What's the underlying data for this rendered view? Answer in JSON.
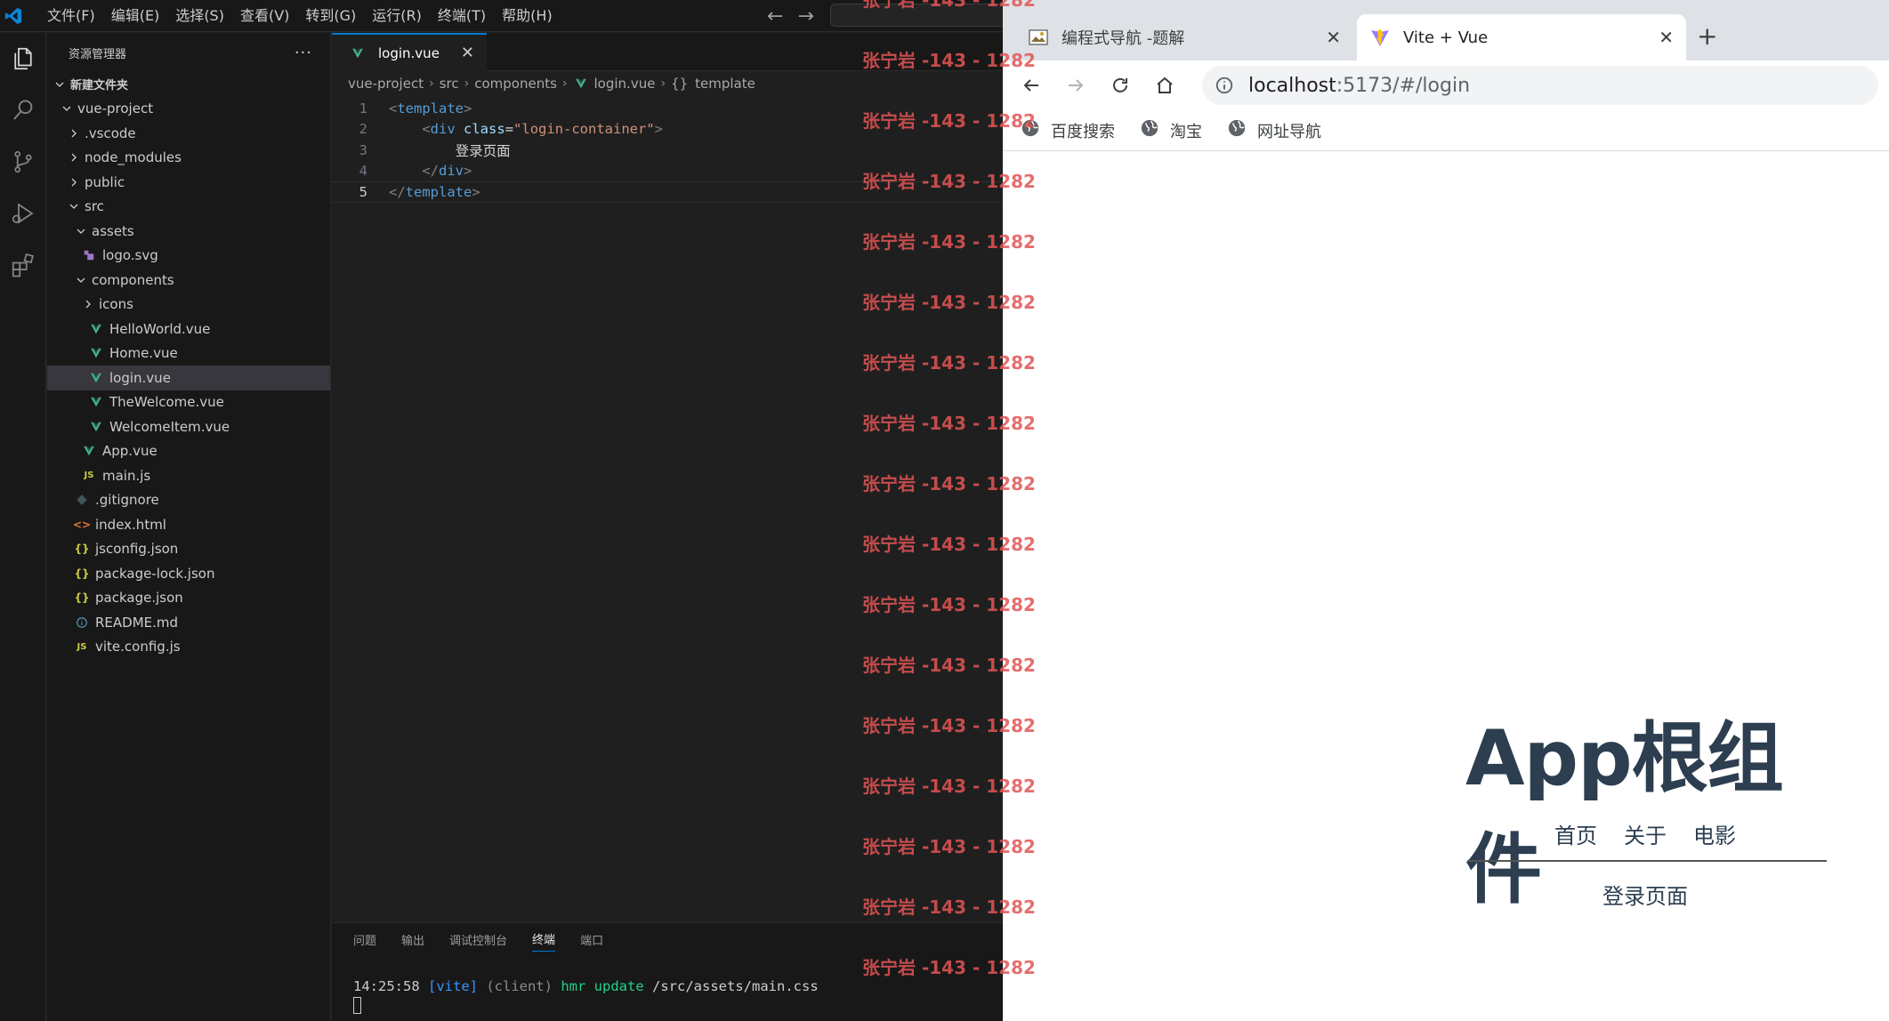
{
  "vscode": {
    "menu": [
      "文件(F)",
      "编辑(E)",
      "选择(S)",
      "查看(V)",
      "转到(G)",
      "运行(R)",
      "终端(T)",
      "帮助(H)"
    ],
    "explorer_title": "资源管理器",
    "explorer_more": "···",
    "folder_root": "新建文件夹",
    "tree": [
      {
        "label": "vue-project",
        "depth": 1,
        "kind": "folder-open"
      },
      {
        "label": ".vscode",
        "depth": 2,
        "kind": "folder"
      },
      {
        "label": "node_modules",
        "depth": 2,
        "kind": "folder"
      },
      {
        "label": "public",
        "depth": 2,
        "kind": "folder"
      },
      {
        "label": "src",
        "depth": 2,
        "kind": "folder-open"
      },
      {
        "label": "assets",
        "depth": 3,
        "kind": "folder-open"
      },
      {
        "label": "logo.svg",
        "depth": 4,
        "kind": "svg"
      },
      {
        "label": "components",
        "depth": 3,
        "kind": "folder-open"
      },
      {
        "label": "icons",
        "depth": 4,
        "kind": "folder"
      },
      {
        "label": "HelloWorld.vue",
        "depth": 5,
        "kind": "vue"
      },
      {
        "label": "Home.vue",
        "depth": 5,
        "kind": "vue"
      },
      {
        "label": "login.vue",
        "depth": 5,
        "kind": "vue",
        "selected": true
      },
      {
        "label": "TheWelcome.vue",
        "depth": 5,
        "kind": "vue"
      },
      {
        "label": "WelcomeItem.vue",
        "depth": 5,
        "kind": "vue"
      },
      {
        "label": "App.vue",
        "depth": 4,
        "kind": "vue"
      },
      {
        "label": "main.js",
        "depth": 4,
        "kind": "js"
      },
      {
        "label": ".gitignore",
        "depth": 3,
        "kind": "git"
      },
      {
        "label": "index.html",
        "depth": 3,
        "kind": "html"
      },
      {
        "label": "jsconfig.json",
        "depth": 3,
        "kind": "json"
      },
      {
        "label": "package-lock.json",
        "depth": 3,
        "kind": "json"
      },
      {
        "label": "package.json",
        "depth": 3,
        "kind": "json"
      },
      {
        "label": "README.md",
        "depth": 3,
        "kind": "info"
      },
      {
        "label": "vite.config.js",
        "depth": 3,
        "kind": "js"
      }
    ],
    "tab": {
      "label": "login.vue",
      "close": "✕"
    },
    "breadcrumb": [
      "vue-project",
      "src",
      "components",
      "login.vue",
      "template"
    ],
    "code_lines": [
      {
        "n": "1",
        "tokens": [
          [
            "tk-punct",
            "<"
          ],
          [
            "tk-tag",
            "template"
          ],
          [
            "tk-punct",
            ">"
          ]
        ]
      },
      {
        "n": "2",
        "tokens": [
          [
            "tk-text",
            "    "
          ],
          [
            "tk-punct",
            "<"
          ],
          [
            "tk-tag",
            "div"
          ],
          [
            "tk-text",
            " "
          ],
          [
            "tk-attr",
            "class"
          ],
          [
            "tk-text",
            "="
          ],
          [
            "tk-str",
            "\"login-container\""
          ],
          [
            "tk-punct",
            ">"
          ]
        ]
      },
      {
        "n": "3",
        "tokens": [
          [
            "tk-text",
            "        登录页面"
          ]
        ]
      },
      {
        "n": "4",
        "tokens": [
          [
            "tk-text",
            "    "
          ],
          [
            "tk-punct",
            "</"
          ],
          [
            "tk-tag",
            "div"
          ],
          [
            "tk-punct",
            ">"
          ]
        ]
      },
      {
        "n": "5",
        "tokens": [
          [
            "tk-punct",
            "</"
          ],
          [
            "tk-tag",
            "template"
          ],
          [
            "tk-punct",
            ">"
          ]
        ],
        "active": true
      }
    ],
    "panel_tabs": [
      "问题",
      "输出",
      "调试控制台",
      "终端",
      "端口"
    ],
    "panel_active": "终端",
    "terminal": {
      "time": "14:25:58",
      "tag": "[vite]",
      "client": "(client)",
      "hmr": "hmr update",
      "path": "/src/assets/main.css"
    }
  },
  "browser": {
    "tabs": [
      {
        "title": "编程式导航 -题解",
        "close": "✕"
      },
      {
        "title": "Vite + Vue",
        "close": "✕"
      }
    ],
    "new_tab": "+",
    "url_host": "localhost",
    "url_rest": ":5173/#/login",
    "bookmarks": [
      "百度搜索",
      "淘宝",
      "网址导航"
    ],
    "page": {
      "title": "App根组件",
      "nav": [
        "首页",
        "关于",
        "电影"
      ],
      "content": "登录页面"
    }
  },
  "watermark": {
    "text": "张宁岩 -143 - 1282",
    "count": 17
  },
  "colors": {
    "accent": "#0078d4",
    "vue_green": "#41b883",
    "watermark": "#e25555",
    "page_text": "#2c3e50"
  }
}
